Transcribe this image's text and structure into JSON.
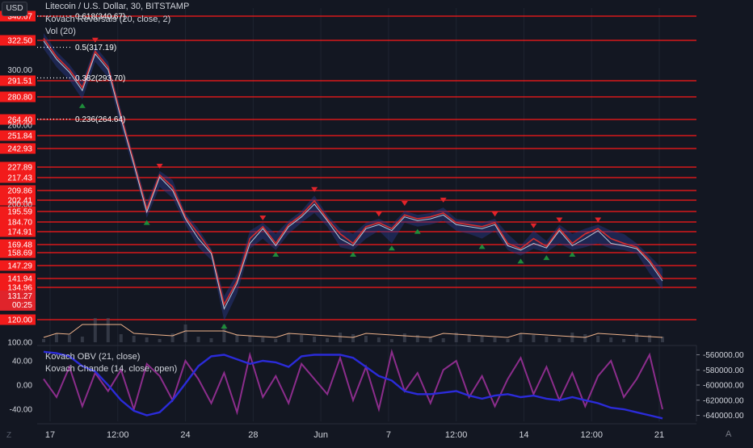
{
  "header": {
    "currency": "USD",
    "symbol_line": "Litecoin / U.S. Dollar, 30, BITSTAMP",
    "indicator_1": "Kovach Reversals (20, close, 2)",
    "indicator_2": "Vol (20)",
    "osc_indicator_1": "Kovach OBV (21, close)",
    "osc_indicator_2": "Kovach Chande (14, close, open)"
  },
  "colors": {
    "background": "#131722",
    "hline": "#ff1a1a",
    "price_tag": "#f21b1b",
    "obv": "#2b2bd9",
    "chande": "#8c2d8c",
    "price_line": "#b8c7d6",
    "band": "#2a3a8c",
    "up_marker": "#1e8c3a",
    "down_marker": "#e0242b",
    "volume_ma": "#f0b48c"
  },
  "chart_data": [
    {
      "type": "line",
      "title": "Litecoin / U.S. Dollar, 30, BITSTAMP",
      "y_axis_side": "left",
      "ylim": [
        100,
        345
      ],
      "y_ticks": [
        100.0,
        200.0,
        260.0,
        300.0
      ],
      "horizontal_levels": [
        340.67,
        322.5,
        291.51,
        280.8,
        264.4,
        251.84,
        242.93,
        227.89,
        217.43,
        209.86,
        202.41,
        195.59,
        184.7,
        174.91,
        169.48,
        158.69,
        147.29,
        141.94,
        134.96,
        120.0
      ],
      "fib_levels": [
        {
          "label": "0.618(340.67)",
          "value": 340.67
        },
        {
          "label": "0.5(317.19)",
          "value": 317.19
        },
        {
          "label": "0.382(293.70)",
          "value": 293.7
        },
        {
          "label": "0.236(264.64)",
          "value": 264.64
        }
      ],
      "last_price": "131.27",
      "countdown": "00:25",
      "x_ticks": [
        "17",
        "12:00",
        "24",
        "28",
        "Jun",
        "7",
        "12:00",
        "14",
        "12:00",
        "21"
      ],
      "series": [
        {
          "name": "Litecoin / U.S. Dollar",
          "x": [
            0,
            1,
            2,
            3,
            4,
            5,
            6,
            7,
            8,
            9,
            10,
            11,
            12,
            13,
            14,
            15,
            16,
            17,
            18,
            19,
            20,
            21,
            22,
            23,
            24,
            25,
            26,
            27,
            28,
            29,
            30,
            31,
            32,
            33,
            34,
            35,
            36,
            37,
            38,
            39,
            40,
            41,
            42,
            43,
            44,
            45,
            46,
            47,
            48
          ],
          "values": [
            322,
            308,
            298,
            285,
            312,
            300,
            265,
            230,
            195,
            218,
            210,
            188,
            172,
            158,
            125,
            138,
            170,
            178,
            168,
            180,
            190,
            200,
            186,
            172,
            168,
            178,
            182,
            176,
            190,
            186,
            188,
            192,
            182,
            180,
            178,
            182,
            168,
            162,
            170,
            165,
            176,
            168,
            172,
            176,
            170,
            168,
            164,
            150,
            140
          ]
        }
      ]
    },
    {
      "type": "line",
      "title": "Kovach Chande (14, close, open)",
      "y_axis_side": "left",
      "ylim": [
        -60,
        60
      ],
      "y_ticks": [
        40.0,
        0.0,
        -40.0
      ],
      "series": [
        {
          "name": "Kovach Chande (14, close, open)",
          "x": [
            0,
            1,
            2,
            3,
            4,
            5,
            6,
            7,
            8,
            9,
            10,
            11,
            12,
            13,
            14,
            15,
            16,
            17,
            18,
            19,
            20,
            21,
            22,
            23,
            24,
            25,
            26,
            27,
            28,
            29,
            30,
            31,
            32,
            33,
            34,
            35,
            36,
            37,
            38,
            39,
            40,
            41,
            42,
            43,
            44,
            45,
            46,
            47,
            48
          ],
          "values": [
            10,
            -20,
            30,
            -35,
            20,
            -10,
            25,
            -40,
            35,
            15,
            -25,
            40,
            10,
            -30,
            20,
            -45,
            50,
            -20,
            15,
            -30,
            35,
            10,
            -15,
            45,
            -25,
            30,
            -40,
            55,
            -10,
            20,
            -30,
            25,
            40,
            -20,
            15,
            -35,
            10,
            45,
            -15,
            30,
            -25,
            20,
            -35,
            15,
            40,
            -20,
            10,
            50,
            -40
          ]
        }
      ]
    },
    {
      "type": "line",
      "title": "Kovach OBV (21, close)",
      "y_axis_side": "right",
      "ylim": [
        -648000,
        -552000
      ],
      "y_ticks": [
        -560000.0,
        -580000.0,
        -600000.0,
        -620000.0,
        -640000.0
      ],
      "series": [
        {
          "name": "Kovach OBV (21, close)",
          "x": [
            0,
            1,
            2,
            3,
            4,
            5,
            6,
            7,
            8,
            9,
            10,
            11,
            12,
            13,
            14,
            15,
            16,
            17,
            18,
            19,
            20,
            21,
            22,
            23,
            24,
            25,
            26,
            27,
            28,
            29,
            30,
            31,
            32,
            33,
            34,
            35,
            36,
            37,
            38,
            39,
            40,
            41,
            42,
            43,
            44,
            45,
            46,
            47,
            48
          ],
          "values": [
            -556000,
            -558000,
            -562000,
            -575000,
            -582000,
            -600000,
            -620000,
            -634000,
            -640000,
            -636000,
            -620000,
            -598000,
            -575000,
            -562000,
            -560000,
            -566000,
            -572000,
            -568000,
            -570000,
            -576000,
            -562000,
            -560000,
            -560000,
            -560000,
            -564000,
            -576000,
            -588000,
            -594000,
            -608000,
            -612000,
            -612000,
            -610000,
            -608000,
            -614000,
            -618000,
            -614000,
            -612000,
            -616000,
            -614000,
            -618000,
            -620000,
            -616000,
            -620000,
            -624000,
            -630000,
            -632000,
            -636000,
            -640000,
            -644000
          ]
        }
      ]
    }
  ]
}
